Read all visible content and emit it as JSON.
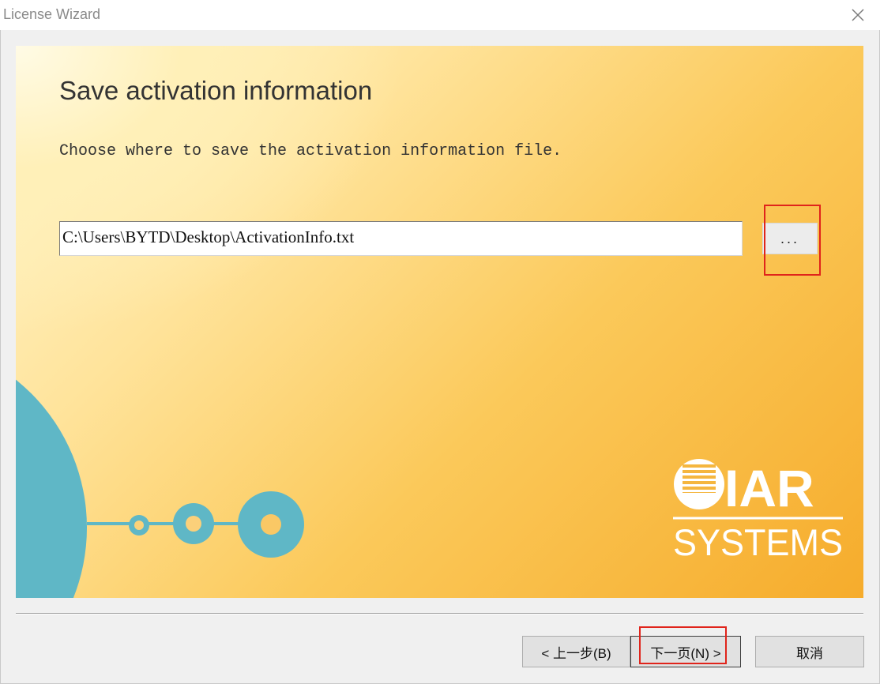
{
  "window": {
    "title": "License Wizard",
    "close_icon": "close-icon"
  },
  "content": {
    "heading": "Save activation information",
    "instruction": "Choose where to save the activation information file.",
    "path_value": "C:\\Users\\BYTD\\Desktop\\ActivationInfo.txt",
    "browse_label": "..."
  },
  "logo": {
    "line1": "IAR",
    "line2": "SYSTEMS"
  },
  "footer": {
    "back_label": "< 上一步(B)",
    "next_label": "下一页(N) >",
    "cancel_label": "取消"
  },
  "colors": {
    "highlight": "#e0241b",
    "disc": "#5fb7c6",
    "panel_warm": "#f6ac2c"
  }
}
